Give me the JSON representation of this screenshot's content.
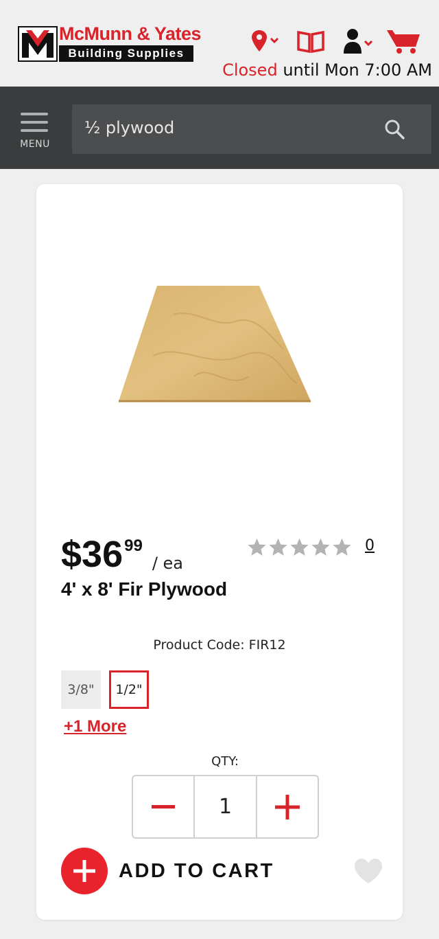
{
  "header": {
    "logo_top": "McMunn & Yates",
    "logo_bottom": "Building Supplies",
    "icons": [
      "location-icon",
      "catalog-book-icon",
      "account-icon",
      "cart-icon"
    ],
    "status_closed": "Closed",
    "status_until": " until Mon 7:00 AM"
  },
  "nav": {
    "menu_label": "MENU",
    "search_value": "½ plywood"
  },
  "product": {
    "price_dollars": "$36",
    "price_cents": "99",
    "price_unit": "/ ea",
    "rating_stars": 0,
    "review_count": "0",
    "title": "4' x 8' Fir Plywood",
    "product_code": "Product Code: FIR12",
    "variants": [
      {
        "label": "3/8\"",
        "selected": false
      },
      {
        "label": "1/2\"",
        "selected": true
      }
    ],
    "more_variants": "+1 More",
    "qty_label": "QTY:",
    "quantity": "1",
    "add_to_cart": "ADD TO CART"
  },
  "colors": {
    "brand_red": "#d8232a",
    "nav_dark": "#3a3c3d",
    "star_gray": "#b3b3b3"
  }
}
